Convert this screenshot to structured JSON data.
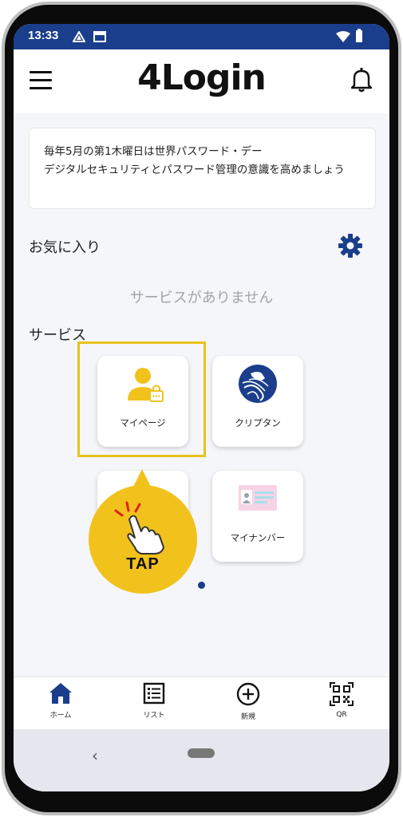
{
  "status": {
    "time": "13:33"
  },
  "app": {
    "title": "4Login"
  },
  "notice": {
    "text": "毎年5月の第1木曜日は世界パスワード・デー\nデジタルセキュリティとパスワード管理の意識を高めましょう"
  },
  "favorites": {
    "title": "お気に入り",
    "empty": "サービスがありません"
  },
  "services": {
    "title": "サービス",
    "tiles": [
      {
        "label": "マイページ",
        "icon": "user-lock-icon"
      },
      {
        "label": "クリプタン",
        "icon": "cryptan-logo-icon"
      },
      {
        "label": "",
        "icon": "hidden"
      },
      {
        "label": "マイナンバー",
        "icon": "id-card-icon"
      }
    ]
  },
  "tap": {
    "label": "TAP"
  },
  "nav": [
    {
      "label": "ホーム",
      "icon": "home-icon"
    },
    {
      "label": "リスト",
      "icon": "list-icon"
    },
    {
      "label": "新規",
      "icon": "plus-circle-icon"
    },
    {
      "label": "QR",
      "icon": "qr-icon"
    }
  ],
  "colors": {
    "primary": "#1a3e8c",
    "accent": "#f2c21c",
    "muted": "#a0a4ab"
  }
}
